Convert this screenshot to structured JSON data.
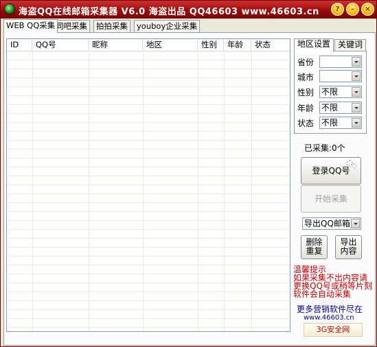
{
  "window": {
    "title": "海盗QQ在线邮箱采集器 V6.0   海盗出品 QQ46603 www.46603.cn"
  },
  "titlebar_buttons": {
    "help": "?",
    "minimize": "–",
    "close": "×"
  },
  "tabs": [
    {
      "label": "WEB QQ采集",
      "active": true
    },
    {
      "label": "同吧采集",
      "active": false
    },
    {
      "label": "拍拍采集",
      "active": false
    },
    {
      "label": "youboy企业采集",
      "active": false
    }
  ],
  "table": {
    "columns": [
      "ID",
      "QQ号",
      "昵称",
      "地区",
      "性别",
      "年龄",
      "状态"
    ],
    "rows": []
  },
  "side_tabs": [
    {
      "label": "地区设置",
      "active": true
    },
    {
      "label": "关键词",
      "active": false
    }
  ],
  "filters": [
    {
      "label": "省份",
      "value": ""
    },
    {
      "label": "城市",
      "value": ""
    },
    {
      "label": "性别",
      "value": "不限"
    },
    {
      "label": "年龄",
      "value": "不限"
    },
    {
      "label": "状态",
      "value": "不限"
    }
  ],
  "status": {
    "collected": "已采集:0个"
  },
  "buttons": {
    "login": "登录QQ号",
    "start": "开始采集",
    "delete_dup": "删除\n重复",
    "export_content": "导出\n内容"
  },
  "export_select": {
    "value": "导出QQ邮箱"
  },
  "hint": {
    "text": "温馨提示\n如果采集不出内容请\n更换QQ号或稍等片刻\n软件会自动采集"
  },
  "promo": {
    "text": "更多营销软件尽在",
    "url": "www.46603.cn",
    "badge": "3G安全网"
  },
  "colors": {
    "titlebar": "#9a0c0c",
    "hint_text": "#cc0000",
    "promo_text": "#0000a0"
  }
}
